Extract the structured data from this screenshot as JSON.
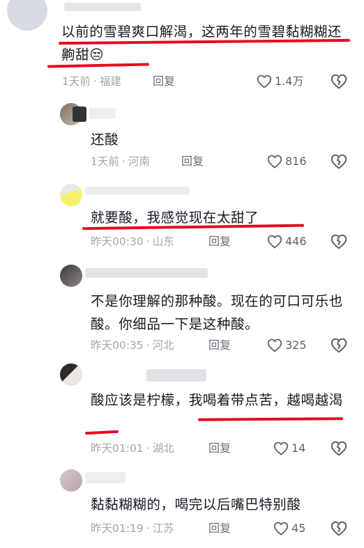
{
  "comments": [
    {
      "text": "以前的雪碧爽口解渴，这两年的雪碧黏糊糊还齁甜",
      "emoji": "😒",
      "time": "1天前",
      "location": "福建",
      "reply": "回复",
      "likes": "1.4万"
    },
    {
      "text": "还酸",
      "time": "1天前",
      "location": "河南",
      "reply": "回复",
      "likes": "816"
    },
    {
      "text": "就要酸，我感觉现在太甜了",
      "time": "昨天00:30",
      "location": "山东",
      "reply": "回复",
      "likes": "446"
    },
    {
      "text": "不是你理解的那种酸。现在的可口可乐也酸。你细品一下是这种酸。",
      "time": "昨天00:35",
      "location": "河北",
      "reply": "回复",
      "likes": "325"
    },
    {
      "text": "酸应该是柠檬，我喝着带点苦，越喝越渴",
      "time": "昨天01:01",
      "location": "湖北",
      "reply": "回复",
      "likes": "14"
    },
    {
      "text": "黏黏糊糊的，喝完以后嘴巴特别酸",
      "time": "昨天01:19",
      "location": "江苏",
      "reply": "回复",
      "likes": "45"
    }
  ],
  "meta_separator": "·",
  "colors": {
    "underline": "#e8091f",
    "meta": "#a3a5ad",
    "reply": "#6b6d78",
    "text": "#161823"
  },
  "icons": [
    "heart-outline-icon",
    "dislike-broken-heart-icon"
  ]
}
